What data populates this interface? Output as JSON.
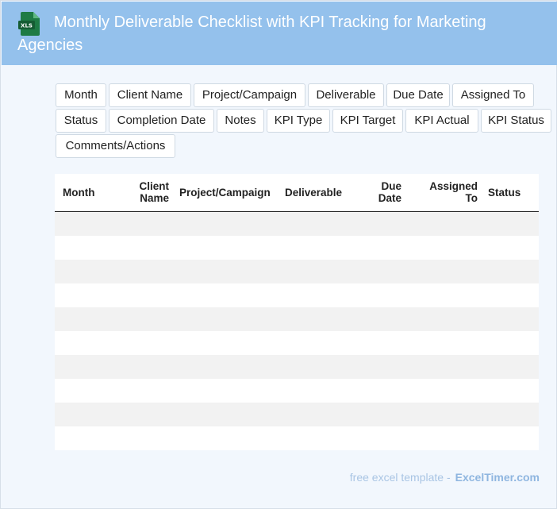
{
  "header": {
    "icon": "xls-file-icon",
    "icon_label": "XLS",
    "title": "Monthly Deliverable Checklist with KPI Tracking for Marketing Agencies"
  },
  "fields": [
    "Month",
    "Client Name",
    "Project/Campaign",
    "Deliverable",
    "Due Date",
    "Assigned To",
    "Status",
    "Completion Date",
    "Notes",
    "KPI Type",
    "KPI Target",
    "KPI Actual",
    "KPI Status",
    "Comments/Actions"
  ],
  "table": {
    "columns": [
      {
        "label": "Month"
      },
      {
        "label": "Client Name"
      },
      {
        "label": "Project/Campaign"
      },
      {
        "label": "Deliverable"
      },
      {
        "label": "Due Date"
      },
      {
        "label": "Assigned To"
      },
      {
        "label": "Status"
      }
    ],
    "rows": [
      [
        "",
        "",
        "",
        "",
        "",
        "",
        ""
      ],
      [
        "",
        "",
        "",
        "",
        "",
        "",
        ""
      ],
      [
        "",
        "",
        "",
        "",
        "",
        "",
        ""
      ],
      [
        "",
        "",
        "",
        "",
        "",
        "",
        ""
      ],
      [
        "",
        "",
        "",
        "",
        "",
        "",
        ""
      ],
      [
        "",
        "",
        "",
        "",
        "",
        "",
        ""
      ],
      [
        "",
        "",
        "",
        "",
        "",
        "",
        ""
      ],
      [
        "",
        "",
        "",
        "",
        "",
        "",
        ""
      ],
      [
        "",
        "",
        "",
        "",
        "",
        "",
        ""
      ],
      [
        "",
        "",
        "",
        "",
        "",
        "",
        ""
      ]
    ]
  },
  "footer": {
    "text": "free excel template -",
    "brand": "ExcelTimer.com"
  },
  "colors": {
    "header_bg": "#94c1ec",
    "page_bg": "#f2f7fd",
    "xls_green": "#1e7b45",
    "row_stripe": "#f2f2f2"
  }
}
